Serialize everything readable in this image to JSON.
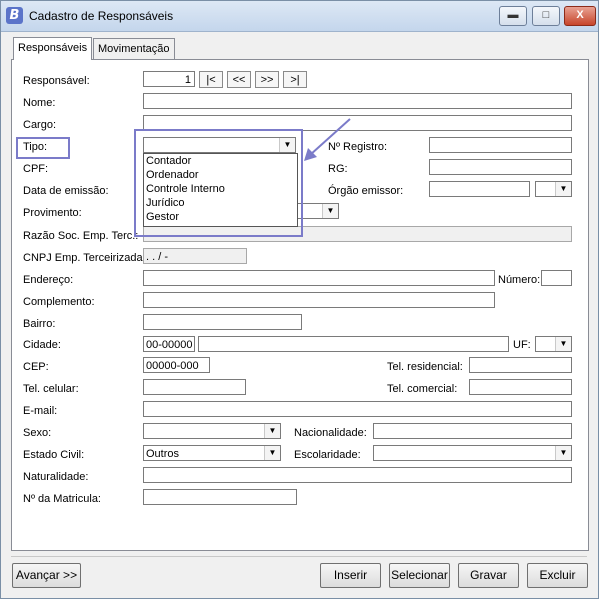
{
  "window": {
    "title": "Cadastro de Responsáveis",
    "app_icon_letter": "B",
    "min_glyph": "▬",
    "max_glyph": "□",
    "close_glyph": "X"
  },
  "tabs": [
    {
      "label": "Responsáveis",
      "active": true
    },
    {
      "label": "Movimentação",
      "active": false
    }
  ],
  "form": {
    "responsavel_label": "Responsável:",
    "responsavel_value": "1",
    "nav": {
      "first": "|<",
      "prev": "<<",
      "next": ">>",
      "last": ">|"
    },
    "nome_label": "Nome:",
    "nome_value": "",
    "cargo_label": "Cargo:",
    "cargo_value": "",
    "tipo_label": "Tipo:",
    "tipo_value": "",
    "tipo_options": [
      "Contador",
      "Ordenador",
      "Controle Interno",
      "Jurídico",
      "Gestor"
    ],
    "registro_label": "Nº Registro:",
    "cpf_label": "CPF:",
    "rg_label": "RG:",
    "data_emissao_label": "Data de emissão:",
    "orgao_emissor_label": "Órgão emissor:",
    "provimento_label": "Provimento:",
    "razao_social_label": "Razão Soc. Emp. Terc.:",
    "cnpj_label": "CNPJ Emp. Terceirizada:",
    "cnpj_value": " .  .  /  -",
    "endereco_label": "Endereço:",
    "numero_label": "Número:",
    "complemento_label": "Complemento:",
    "bairro_label": "Bairro:",
    "cidade_label": "Cidade:",
    "cidade_code": "00-00000",
    "uf_label": "UF:",
    "cep_label": "CEP:",
    "cep_value": "00000-000",
    "tel_residencial_label": "Tel. residencial:",
    "tel_celular_label": "Tel. celular:",
    "tel_comercial_label": "Tel. comercial:",
    "email_label": "E-mail:",
    "sexo_label": "Sexo:",
    "nacionalidade_label": "Nacionalidade:",
    "estado_civil_label": "Estado Civil:",
    "estado_civil_value": "Outros",
    "escolaridade_label": "Escolaridade:",
    "naturalidade_label": "Naturalidade:",
    "matricula_label": "Nº da Matricula:"
  },
  "buttons": {
    "avancar": "Avançar >>",
    "inserir": "Inserir",
    "selecionar": "Selecionar",
    "gravar": "Gravar",
    "excluir": "Excluir"
  },
  "annotation_color": "#7b7bc9"
}
